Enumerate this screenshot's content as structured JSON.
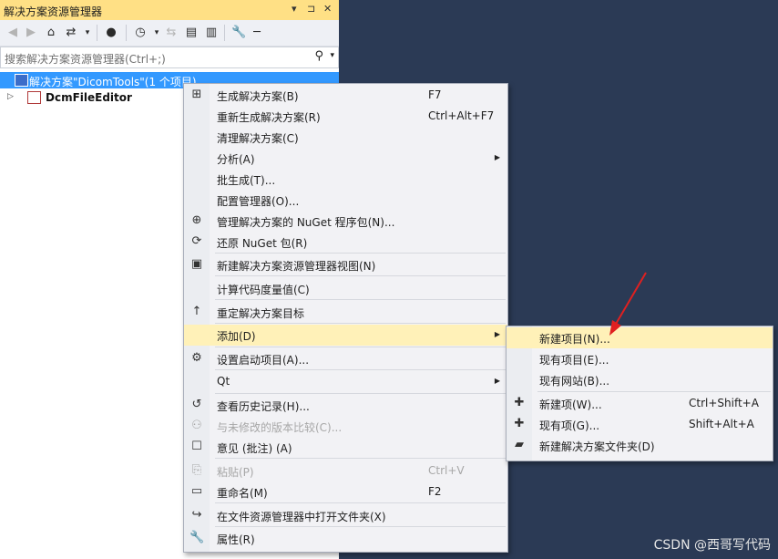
{
  "panel": {
    "title": "解决方案资源管理器",
    "title_buttons": [
      "▾",
      "⊐",
      "✕"
    ],
    "search_placeholder": "搜索解决方案资源管理器(Ctrl+;)",
    "tree": [
      {
        "label": "解决方案\"DicomTools\"(1 个项目)",
        "selected": true
      },
      {
        "label": "DcmFileEditor",
        "selected": false
      }
    ]
  },
  "context_menu": {
    "items": [
      {
        "label": "生成解决方案(B)",
        "shortcut": "F7",
        "icon": "build-icon",
        "glyph": "⊞"
      },
      {
        "label": "重新生成解决方案(R)",
        "shortcut": "Ctrl+Alt+F7"
      },
      {
        "label": "清理解决方案(C)"
      },
      {
        "label": "分析(A)",
        "submenu": true
      },
      {
        "label": "批生成(T)..."
      },
      {
        "label": "配置管理器(O)..."
      },
      {
        "label": "管理解决方案的 NuGet 程序包(N)...",
        "icon": "nuget-icon",
        "glyph": "⊕"
      },
      {
        "label": "还原 NuGet 包(R)",
        "icon": "restore-icon",
        "glyph": "⟳"
      },
      {
        "label": "新建解决方案资源管理器视图(N)",
        "icon": "new-view-icon",
        "glyph": "▣"
      },
      {
        "label": "计算代码度量值(C)"
      },
      {
        "label": "重定解决方案目标",
        "icon": "retarget-icon",
        "glyph": "↑"
      },
      {
        "label": "添加(D)",
        "submenu": true,
        "highlighted": true
      },
      {
        "label": "设置启动项目(A)...",
        "icon": "settings-icon",
        "glyph": "⚙"
      },
      {
        "label": "Qt",
        "submenu": true
      },
      {
        "label": "查看历史记录(H)...",
        "icon": "history-icon",
        "glyph": "↺"
      },
      {
        "label": "与未修改的版本比较(C)...",
        "disabled": true,
        "icon": "compare-icon",
        "glyph": "⚇"
      },
      {
        "label": "意见 (批注) (A)",
        "icon": "comment-icon",
        "glyph": "☐"
      },
      {
        "label": "粘贴(P)",
        "shortcut": "Ctrl+V",
        "disabled": true,
        "icon": "paste-icon",
        "glyph": "⎘"
      },
      {
        "label": "重命名(M)",
        "shortcut": "F2",
        "icon": "rename-icon",
        "glyph": "▭"
      },
      {
        "label": "在文件资源管理器中打开文件夹(X)",
        "icon": "open-folder-icon",
        "glyph": "↪"
      },
      {
        "label": "属性(R)",
        "icon": "properties-icon",
        "glyph": "🔧"
      }
    ]
  },
  "submenu": {
    "items": [
      {
        "label": "新建项目(N)...",
        "highlighted": true
      },
      {
        "label": "现有项目(E)..."
      },
      {
        "label": "现有网站(B)..."
      },
      {
        "label": "新建项(W)...",
        "shortcut": "Ctrl+Shift+A",
        "icon": "new-item-icon",
        "glyph": "✚"
      },
      {
        "label": "现有项(G)...",
        "shortcut": "Shift+Alt+A",
        "icon": "existing-item-icon",
        "glyph": "✚"
      },
      {
        "label": "新建解决方案文件夹(D)",
        "icon": "solution-folder-icon",
        "glyph": "▰"
      }
    ]
  },
  "watermark": "CSDN @西哥写代码",
  "colors": {
    "accent": "#3399ff",
    "highlight": "#fff1b8",
    "titlebar": "#ffe085",
    "background": "#2b3a55",
    "arrow": "#e02020"
  }
}
